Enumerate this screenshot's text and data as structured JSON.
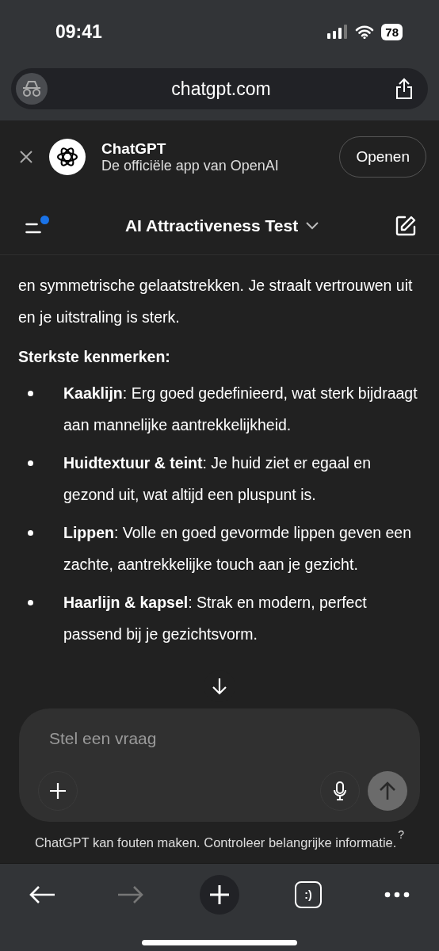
{
  "status_bar": {
    "time": "09:41",
    "battery": "78"
  },
  "address_bar": {
    "url": "chatgpt.com"
  },
  "app_banner": {
    "name": "ChatGPT",
    "subtitle": "De officiële app van OpenAI",
    "button": "Openen"
  },
  "header": {
    "title": "AI Attractiveness Test",
    "unread": true
  },
  "message": {
    "paragraph": "en symmetrische gelaatstrekken. Je straalt vertrouwen uit en je uitstraling is sterk.",
    "heading": "Sterkste kenmerken:",
    "bullets": [
      {
        "text": "**Kaaklijn**: Erg goed gedefinieerd, wat sterk bijdraagt aan mannelijke aantrekkelijkheid."
      },
      {
        "text": "**Huidtextuur & teint**: Je huid ziet er egaal en gezond uit, wat altijd een pluspunt is."
      },
      {
        "text": "**Lippen**: Volle en goed gevormde lippen geven een zachte, aantrekkelijke touch aan je gezicht."
      },
      {
        "text": "**Haarlijn & kapsel**: Strak en modern, perfect passend bij je gezichtsvorm."
      }
    ]
  },
  "composer": {
    "placeholder": "Stel een vraag"
  },
  "disclaimer": "ChatGPT kan fouten maken. Controleer belangrijke informatie.",
  "help": "?",
  "toolbar": {
    "buttons": [
      {
        "kind": "back",
        "disabled": false
      },
      {
        "kind": "forward",
        "disabled": true
      },
      {
        "kind": "new-tab",
        "disabled": false
      },
      {
        "kind": "tabs",
        "label": ":)",
        "disabled": false
      },
      {
        "kind": "more",
        "disabled": false
      }
    ]
  }
}
